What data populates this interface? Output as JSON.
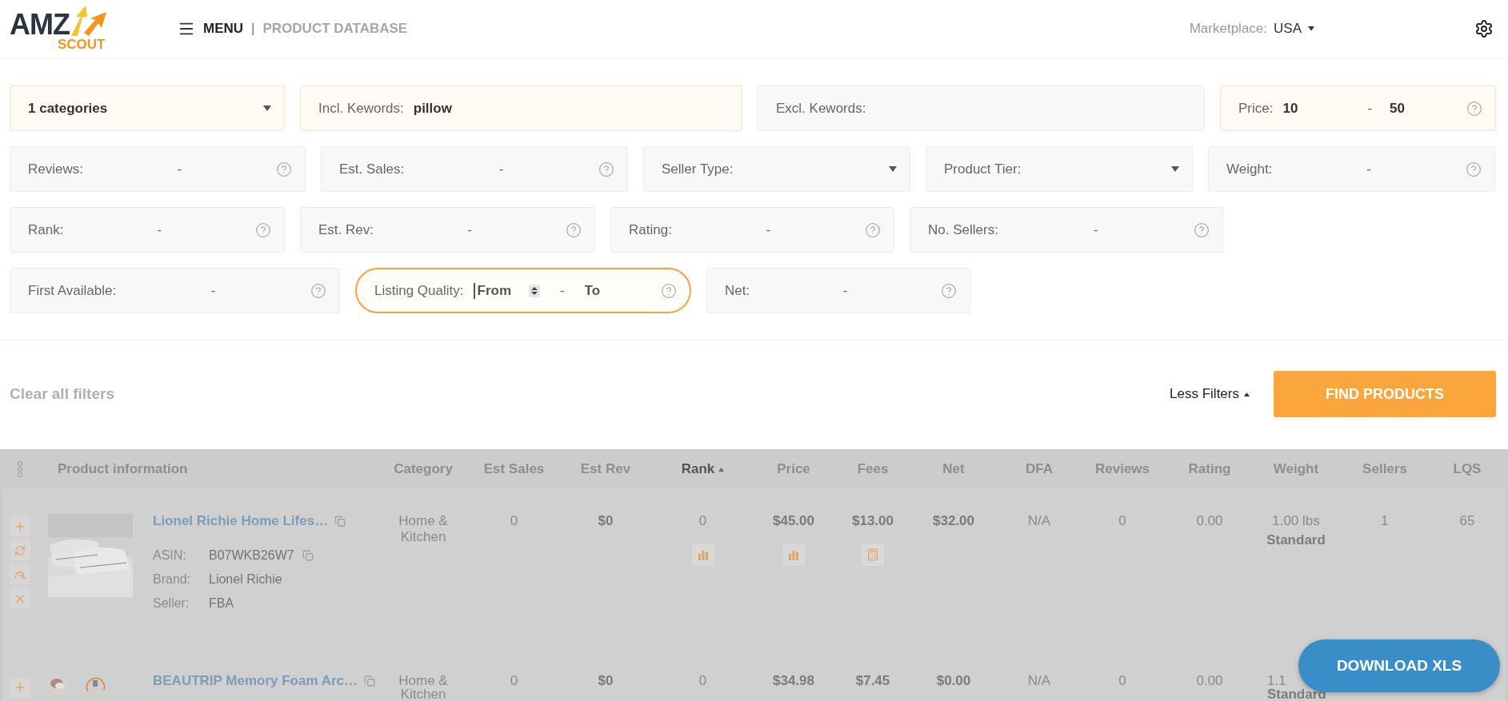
{
  "header": {
    "logo": {
      "top": "AMZ",
      "bottom": "SCOUT"
    },
    "menu_label": "MENU",
    "separator": "|",
    "section": "PRODUCT DATABASE",
    "marketplace_label": "Marketplace:",
    "marketplace_value": "USA"
  },
  "filters": [
    {
      "kind": "select",
      "value": "1 categories",
      "active": true,
      "highlighted": false
    },
    {
      "kind": "text",
      "label": "Incl. Kewords:",
      "value": "pillow",
      "active": true,
      "highlighted": false
    },
    {
      "kind": "text",
      "label": "Excl. Kewords:",
      "active": false,
      "highlighted": false
    },
    {
      "kind": "range",
      "label": "Price:",
      "from": {
        "value": "10"
      },
      "separator": "-",
      "to": {
        "value": "50"
      },
      "help": true,
      "active": true,
      "highlighted": false
    },
    {
      "kind": "range",
      "label": "Reviews:",
      "separator": "-",
      "help": true,
      "active": false,
      "highlighted": false
    },
    {
      "kind": "range",
      "label": "Est. Sales:",
      "separator": "-",
      "help": true,
      "active": false,
      "highlighted": false
    },
    {
      "kind": "select",
      "label": "Seller Type:",
      "active": false,
      "highlighted": false
    },
    {
      "kind": "select",
      "label": "Product Tier:",
      "active": false,
      "highlighted": false
    },
    {
      "kind": "range",
      "label": "Weight:",
      "separator": "-",
      "help": true,
      "active": false,
      "highlighted": false
    },
    {
      "kind": "range",
      "label": "Rank:",
      "separator": "-",
      "help": true,
      "active": false,
      "highlighted": false
    },
    {
      "kind": "range",
      "label": "Est. Rev:",
      "separator": "-",
      "help": true,
      "active": false,
      "highlighted": false
    },
    {
      "kind": "range",
      "label": "Rating:",
      "separator": "-",
      "help": true,
      "active": false,
      "highlighted": false
    },
    {
      "kind": "range",
      "label": "No. Sellers:",
      "separator": "-",
      "help": true,
      "active": false,
      "highlighted": false
    },
    {
      "kind": "range",
      "label": "First Available:",
      "separator": "-",
      "help": true,
      "active": false,
      "highlighted": false
    },
    {
      "kind": "range",
      "label": "Listing Quality:",
      "from": {
        "placeholder": "From",
        "focused": true,
        "spinner": true
      },
      "separator": "-",
      "to": {
        "placeholder": "To"
      },
      "help": true,
      "active": false,
      "highlighted": true
    },
    {
      "kind": "range",
      "label": "Net:",
      "separator": "-",
      "help": true,
      "active": false,
      "highlighted": false
    }
  ],
  "actions": {
    "clear": "Clear all filters",
    "toggle": "Less Filters",
    "find": "FIND PRODUCTS"
  },
  "table": {
    "columns": [
      {
        "label": "Product information",
        "sorted": false
      },
      {
        "label": "Category",
        "sorted": false
      },
      {
        "label": "Est Sales",
        "sorted": false
      },
      {
        "label": "Est Rev",
        "sorted": false
      },
      {
        "label": "Rank",
        "sorted": true
      },
      {
        "label": "Price",
        "sorted": false
      },
      {
        "label": "Fees",
        "sorted": false
      },
      {
        "label": "Net",
        "sorted": false
      },
      {
        "label": "DFA",
        "sorted": false
      },
      {
        "label": "Reviews",
        "sorted": false
      },
      {
        "label": "Rating",
        "sorted": false
      },
      {
        "label": "Weight",
        "sorted": false
      },
      {
        "label": "Sellers",
        "sorted": false
      },
      {
        "label": "LQS",
        "sorted": false
      }
    ],
    "rows": [
      {
        "kind": "full",
        "title": "Lionel Richie Home Lifes…",
        "details": [
          {
            "label": "ASIN:",
            "value": "B07WKB26W7",
            "copy": true
          },
          {
            "label": "Brand:",
            "value": "Lionel Richie",
            "copy": false
          },
          {
            "label": "Seller:",
            "value": "FBA",
            "copy": false
          }
        ],
        "category": "Home & Kitchen",
        "est_sales": "0",
        "est_rev": "$0",
        "rank": "0",
        "price": "$45.00",
        "fees": "$13.00",
        "net": "$32.00",
        "dfa": "N/A",
        "reviews": "0",
        "rating": "0.00",
        "weight": "1.00 lbs",
        "size_tier": "Standard",
        "sellers": "1",
        "lqs": "65"
      },
      {
        "kind": "cut",
        "title": "BEAUTRIP Memory Foam Arc…",
        "category": "Home & Kitchen",
        "est_sales": "0",
        "est_rev": "$0",
        "rank": "0",
        "price": "$34.98",
        "fees": "$7.45",
        "net": "$0.00",
        "dfa": "N/A",
        "reviews": "0",
        "rating": "0.00",
        "weight": "1.1",
        "size_tier": "Standard"
      }
    ]
  },
  "download": "DOWNLOAD XLS"
}
